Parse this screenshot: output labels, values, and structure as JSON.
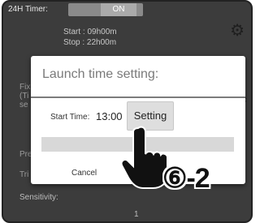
{
  "background": {
    "timer_label": "24H Timer:",
    "toggle_label": "ON",
    "start_line": "Start : 09h00m",
    "stop_line": "Stop : 22h00m",
    "fragment_1": "Fix",
    "fragment_2": "(Ti",
    "fragment_3": "se",
    "fragment_pre": "Pre",
    "fragment_tri": "Tri",
    "sensitivity_label": "Sensitivity:",
    "sensitivity_value": "1"
  },
  "dialog": {
    "title": "Launch time setting:",
    "start_time_label": "Start Time:",
    "start_time_value": "13:00",
    "setting_button": "Setting",
    "cancel_button": "Cancel"
  },
  "annotation": {
    "step_label": "⑥-2"
  },
  "icons": [
    "gear-icon",
    "pointing-hand-icon"
  ],
  "colors": {
    "overlay": "#3c3c3c",
    "dialog_bg": "#ffffff",
    "title_text": "#7a7a7a"
  }
}
